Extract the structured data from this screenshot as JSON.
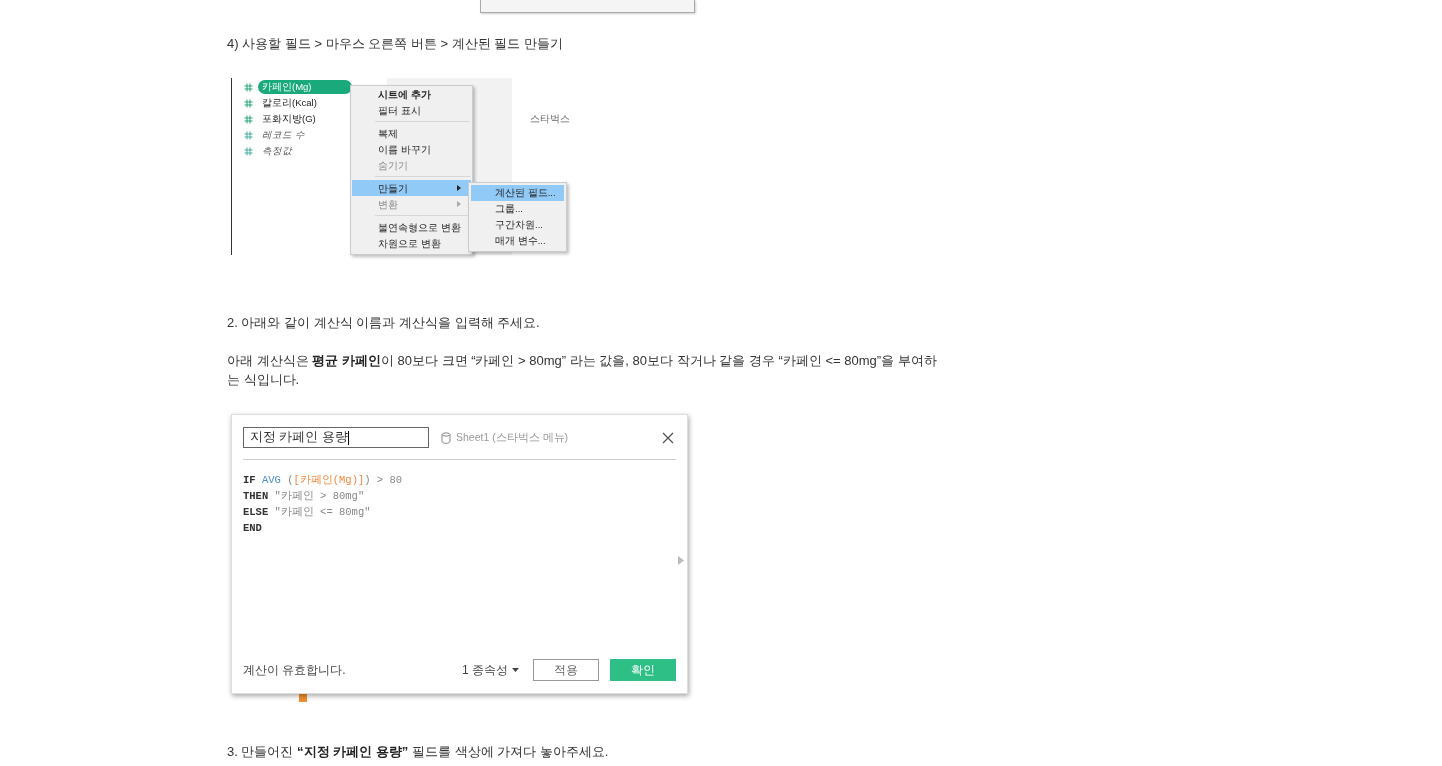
{
  "step_4": "4) 사용할 필드 > 마우스 오른쪽 버튼 > 계산된 필드 만들기",
  "field_menu_screenshot": {
    "fields": [
      {
        "label": "카페인(Mg)",
        "kind": "measure",
        "selected": true
      },
      {
        "label": "칼로리(Kcal)",
        "kind": "measure",
        "selected": false
      },
      {
        "label": "포화지방(G)",
        "kind": "measure",
        "selected": false
      },
      {
        "label": "레코드 수",
        "kind": "generated",
        "selected": false
      },
      {
        "label": "측정값",
        "kind": "generated",
        "selected": false
      }
    ],
    "sheet_label": "스타벅스",
    "context_menu": [
      [
        {
          "label": "시트에 추가",
          "bold": true,
          "disabled": false,
          "selected": false,
          "submenu": false
        },
        {
          "label": "필터 표시",
          "bold": false,
          "disabled": false,
          "selected": false,
          "submenu": false
        }
      ],
      [
        {
          "label": "복제",
          "bold": false,
          "disabled": false,
          "selected": false,
          "submenu": false
        },
        {
          "label": "이름 바꾸기",
          "bold": false,
          "disabled": false,
          "selected": false,
          "submenu": false
        },
        {
          "label": "숨기기",
          "bold": false,
          "disabled": true,
          "selected": false,
          "submenu": false
        }
      ],
      [
        {
          "label": "만들기",
          "bold": false,
          "disabled": false,
          "selected": true,
          "submenu": true
        },
        {
          "label": "변환",
          "bold": false,
          "disabled": true,
          "selected": false,
          "submenu": true
        }
      ],
      [
        {
          "label": "불연속형으로 변환",
          "bold": false,
          "disabled": false,
          "selected": false,
          "submenu": false
        },
        {
          "label": "차원으로 변환",
          "bold": false,
          "disabled": false,
          "selected": false,
          "submenu": false
        }
      ]
    ],
    "submenu": [
      {
        "label": "계산된 필드...",
        "selected": true
      },
      {
        "label": "그룹...",
        "selected": false
      },
      {
        "label": "구간차원...",
        "selected": false
      },
      {
        "label": "매개 변수...",
        "selected": false
      }
    ]
  },
  "step_2": "2. 아래와 같이 계산식 이름과 계산식을 입력해 주세요.",
  "explanation": "아래 계산식은 **평균 카페인**이 80보다 크면 “카페인 > 80mg” 라는 값을, 80보다 작거나 같을 경우 “카페인 <= 80mg”을 부여하는 식입니다.",
  "calc_dialog": {
    "name_value": "지정 카페인 용량",
    "data_source": "Sheet1 (스타벅스 메뉴)",
    "formula_lines": [
      [
        {
          "kind": "keyword",
          "text": "IF "
        },
        {
          "kind": "function",
          "text": "AVG "
        },
        {
          "kind": "operator",
          "text": "("
        },
        {
          "kind": "field",
          "text": "[카페인(Mg)]"
        },
        {
          "kind": "operator",
          "text": ") > 80"
        }
      ],
      [
        {
          "kind": "keyword",
          "text": "THEN "
        },
        {
          "kind": "string",
          "text": "\"카페인 > 80mg\""
        }
      ],
      [
        {
          "kind": "keyword",
          "text": "ELSE "
        },
        {
          "kind": "string",
          "text": "\"카페인 <= 80mg\""
        }
      ],
      [
        {
          "kind": "keyword",
          "text": "END"
        }
      ]
    ],
    "status": "계산이 유효합니다.",
    "dependencies": "1 종속성",
    "buttons": [
      {
        "label": "적용",
        "kind": "secondary"
      },
      {
        "label": "확인",
        "kind": "primary"
      }
    ]
  },
  "step_3": "3. 만들어진 **“지정 카페인 용량”** 필드를 색상에 가져다 놓아주세요."
}
